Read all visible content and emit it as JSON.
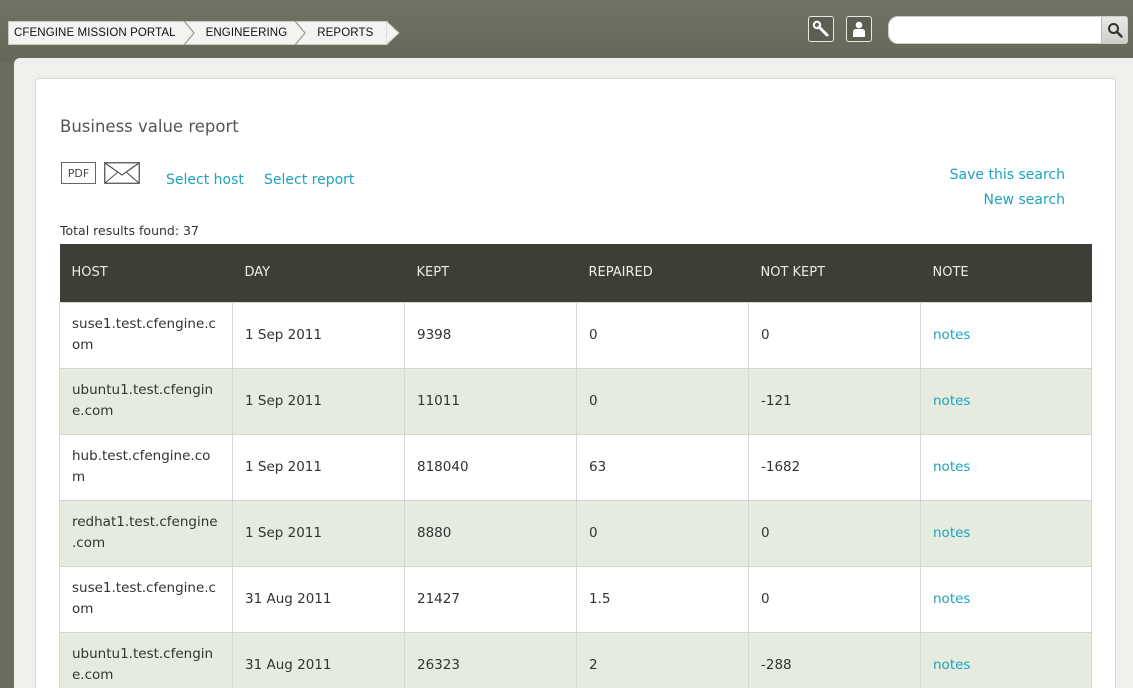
{
  "breadcrumb": [
    "CFENGINE MISSION PORTAL",
    "ENGINEERING",
    "REPORTS"
  ],
  "toolbar": {
    "settings_icon": "wrench-icon",
    "user_icon": "user-icon",
    "search_placeholder": "",
    "search_icon": "search-icon"
  },
  "report": {
    "title": "Business value report",
    "pdf_label": "PDF",
    "select_host": "Select host",
    "select_report": "Select report",
    "save_search": "Save this search",
    "new_search": "New search",
    "total": "Total results found: 37"
  },
  "table": {
    "headers": [
      "HOST",
      "DAY",
      "KEPT",
      "REPAIRED",
      "NOT KEPT",
      "NOTE"
    ],
    "rows": [
      [
        "suse1.test.cfengine.c\nom",
        "1 Sep 2011",
        "9398",
        "0",
        "0",
        "notes"
      ],
      [
        "ubuntu1.test.cfengin\ne.com",
        "1 Sep 2011",
        "11011",
        "0",
        "-121",
        "notes"
      ],
      [
        "hub.test.cfengine.co\nm",
        "1 Sep 2011",
        "818040",
        "63",
        "-1682",
        "notes"
      ],
      [
        "redhat1.test.cfengine\n.com",
        "1 Sep 2011",
        "8880",
        "0",
        "0",
        "notes"
      ],
      [
        "suse1.test.cfengine.c\nom",
        "31 Aug 2011",
        "21427",
        "1.5",
        "0",
        "notes"
      ],
      [
        "ubuntu1.test.cfengin\ne.com",
        "31 Aug 2011",
        "26323",
        "2",
        "-288",
        "notes"
      ]
    ]
  },
  "colors": {
    "link": "#1ea2bd",
    "header_bg": "#3d3f36",
    "alt_row": "#e5ecdf"
  }
}
